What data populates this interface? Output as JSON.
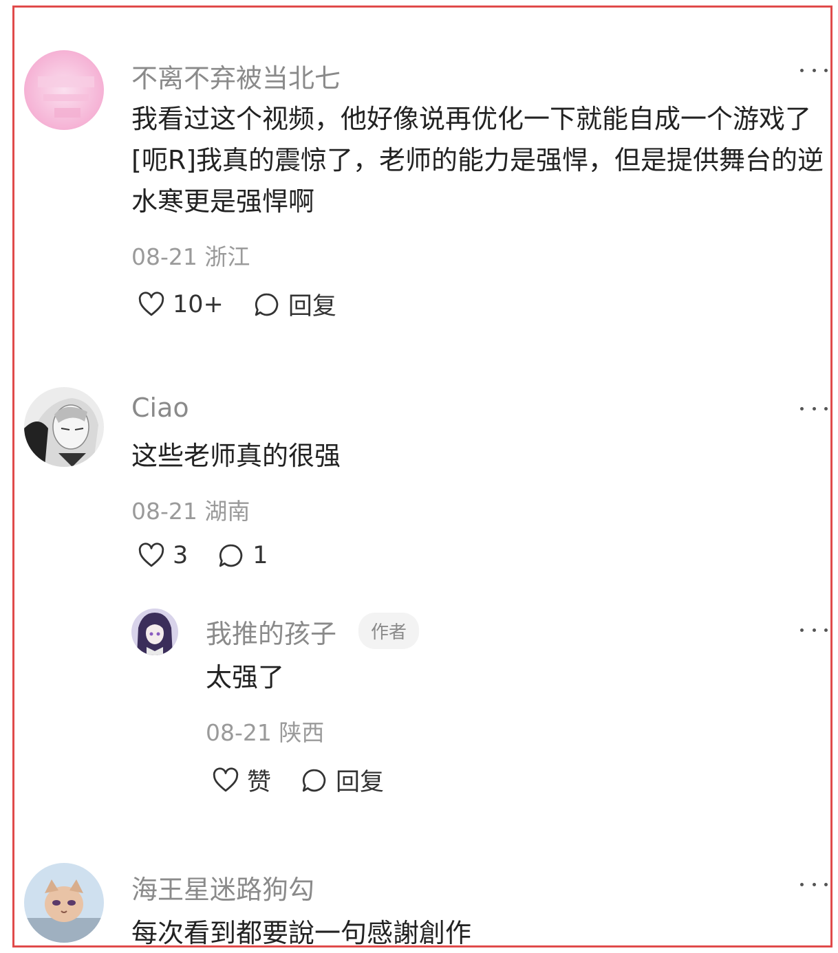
{
  "comments": [
    {
      "username": "不离不弃被当北七",
      "text": "我看过这个视频，他好像说再优化一下就能自成一个游戏了[呃R]我真的震惊了，老师的能力是强悍，但是提供舞台的逆水寒更是强悍啊",
      "date": "08-21",
      "location": "浙江",
      "likes": "10+",
      "reply_label": "回复"
    },
    {
      "username": "Ciao",
      "text": "这些老师真的很强",
      "date": "08-21",
      "location": "湖南",
      "likes": "3",
      "reply_count": "1"
    }
  ],
  "reply": {
    "username": "我推的孩子",
    "badge": "作者",
    "text": "太强了",
    "date": "08-21",
    "location": "陕西",
    "like_label": "赞",
    "reply_label": "回复"
  },
  "last_comment": {
    "username": "海王星迷路狗勾",
    "text": "每次看到都要說一句感謝創作"
  },
  "colors": {
    "border": "#e04a4a",
    "username": "#8a8a8a",
    "text": "#222222",
    "meta": "#9a9a9a"
  },
  "icons": [
    "heart-icon",
    "comment-bubble-icon",
    "more-dots-icon"
  ]
}
